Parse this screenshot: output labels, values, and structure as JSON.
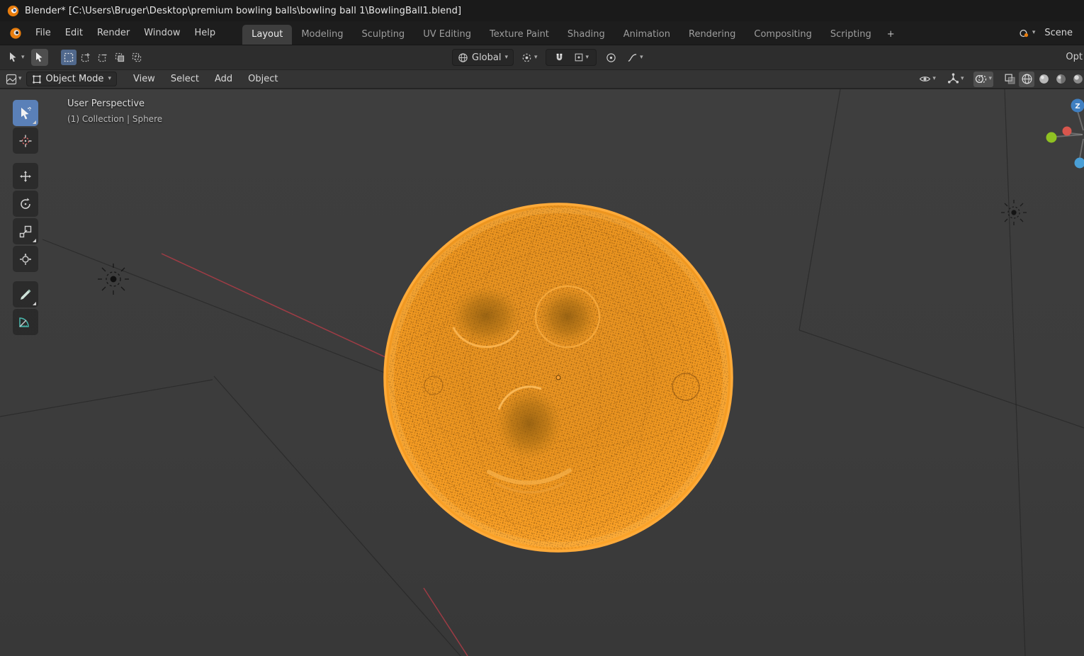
{
  "window": {
    "title": "Blender* [C:\\Users\\Bruger\\Desktop\\premium bowling balls\\bowling ball 1\\BowlingBall1.blend]"
  },
  "menubar": {
    "items": [
      "File",
      "Edit",
      "Render",
      "Window",
      "Help"
    ]
  },
  "workspace_tabs": {
    "items": [
      "Layout",
      "Modeling",
      "Sculpting",
      "UV Editing",
      "Texture Paint",
      "Shading",
      "Animation",
      "Rendering",
      "Compositing",
      "Scripting"
    ],
    "active": "Layout",
    "add_label": "+"
  },
  "scene_selector": {
    "label": "Scene"
  },
  "tool_settings": {
    "orientation_label": "Global",
    "options_label": "Opt"
  },
  "viewport_header": {
    "mode_label": "Object Mode",
    "menus": [
      "View",
      "Select",
      "Add",
      "Object"
    ]
  },
  "viewport_overlay": {
    "view_label": "User Perspective",
    "context_label": "(1) Collection | Sphere"
  },
  "gizmo": {
    "z_label": "Z"
  },
  "icons": {
    "left_toolbar": [
      "select-box-icon",
      "cursor-icon",
      "move-icon",
      "rotate-icon",
      "scale-icon",
      "transform-icon",
      "annotate-icon",
      "measure-icon"
    ],
    "header_right": [
      "visibility-icon",
      "gizmos-icon",
      "overlays-icon",
      "xray-icon",
      "wireframe-shading-icon",
      "solid-shading-icon",
      "material-shading-icon",
      "rendered-shading-icon"
    ],
    "tool_settings": [
      "orientation-globe-icon",
      "pivot-icon",
      "magnet-icon",
      "snap-target-icon",
      "proportional-icon",
      "falloff-curve-icon"
    ]
  },
  "colors": {
    "selection_orange": "#ffab3a",
    "ball_base": "#ec9320",
    "axis_red": "#a23b47",
    "viewport_bg": "#3d3d3d",
    "header_bg": "#1d1d1d",
    "active_tool_blue": "#5a80b8"
  }
}
